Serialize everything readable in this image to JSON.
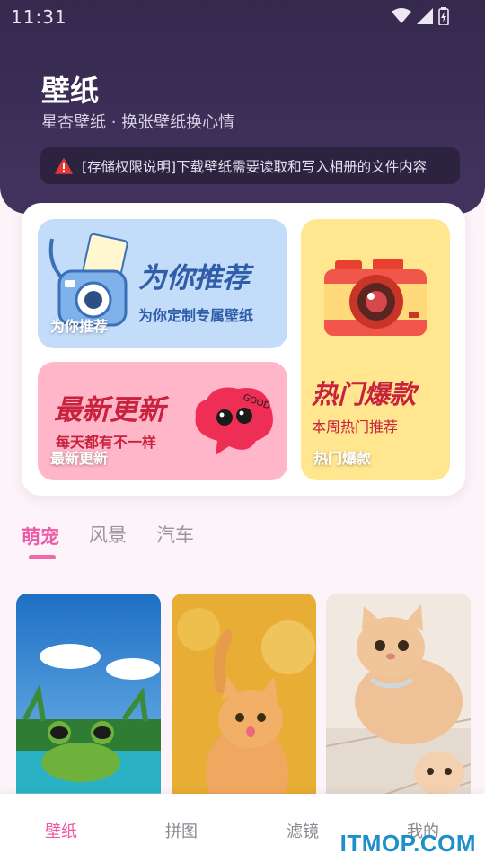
{
  "status_bar": {
    "time": "11:31"
  },
  "header": {
    "title": "壁纸",
    "subtitle": "星杏壁纸 · 换张壁纸换心情",
    "notice": "[存储权限说明]下载壁纸需要读取和写入相册的文件内容"
  },
  "features": {
    "recommend": {
      "heading": "为你推荐",
      "sub": "为你定制专属壁纸",
      "label": "为你推荐"
    },
    "latest": {
      "heading": "最新更新",
      "sub": "每天都有不一样",
      "label": "最新更新"
    },
    "hot": {
      "heading": "热门爆款",
      "sub": "本周热门推荐",
      "label": "热门爆款"
    }
  },
  "tabs": [
    {
      "label": "萌宠",
      "active": true
    },
    {
      "label": "风景",
      "active": false
    },
    {
      "label": "汽车",
      "active": false
    }
  ],
  "bottom_nav": [
    {
      "label": "壁纸",
      "active": true
    },
    {
      "label": "拼图",
      "active": false
    },
    {
      "label": "滤镜",
      "active": false
    },
    {
      "label": "我的",
      "active": false
    }
  ],
  "watermark": "ITMOP.COM",
  "colors": {
    "accent": "#ee5aa8",
    "header_bg": "#3a2d55",
    "notice_icon": "#e53935"
  }
}
